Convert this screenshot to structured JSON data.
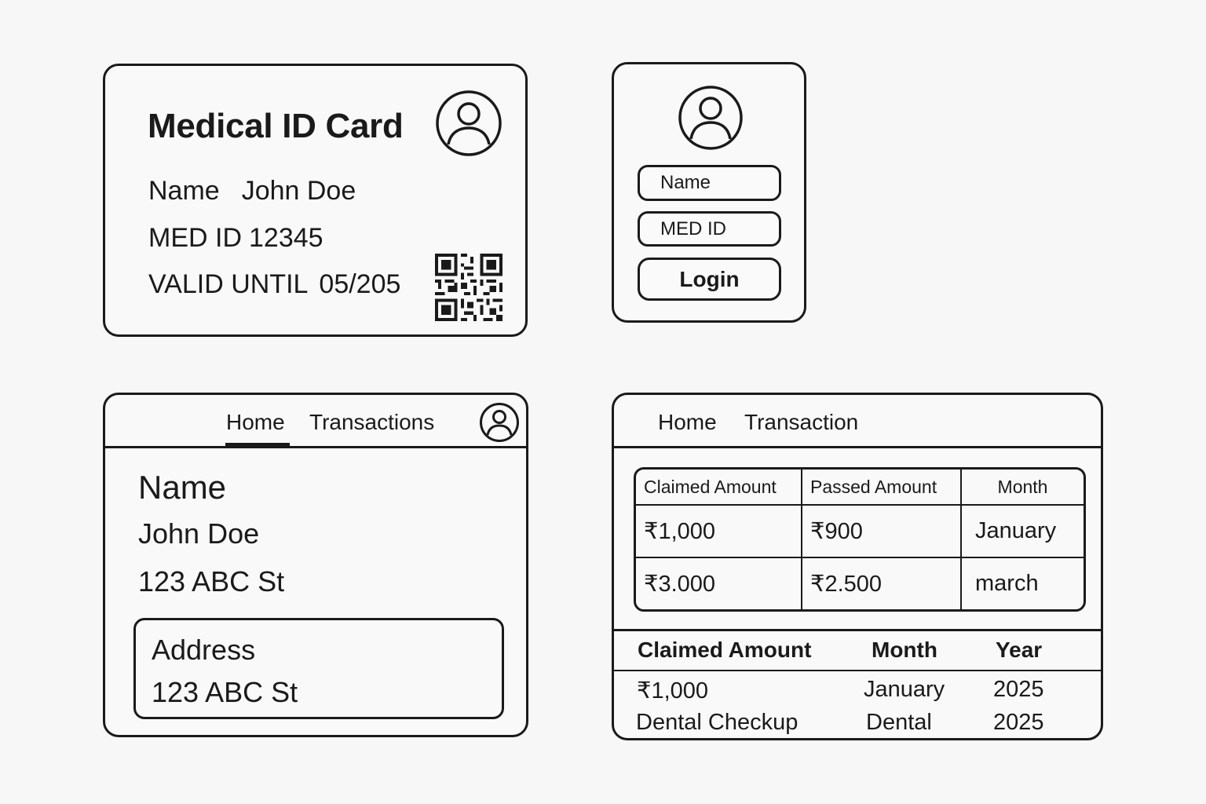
{
  "id_card": {
    "title": "Medical ID Card",
    "name_label": "Name",
    "name_value": "John Doe",
    "med_id_label": "MED ID",
    "med_id_value": "12345",
    "valid_label": "VALID UNTIL",
    "valid_value": "05/205",
    "icons": {
      "avatar": "user-avatar-icon",
      "qr": "qr-code-icon"
    }
  },
  "login": {
    "name_placeholder": "Name",
    "med_id_placeholder": "MED ID",
    "login_label": "Login",
    "icons": {
      "avatar": "user-avatar-icon"
    }
  },
  "profile": {
    "nav": {
      "home": "Home",
      "transactions": "Transactions"
    },
    "name_label": "Name",
    "name_value": "John Doe",
    "address_value": "123 ABC St",
    "address_box": {
      "label": "Address",
      "value": "123 ABC St"
    },
    "icons": {
      "avatar": "user-avatar-icon"
    }
  },
  "transactions": {
    "nav": {
      "home": "Home",
      "transaction": "Transaction"
    },
    "table": {
      "headers": [
        "Claimed Amount",
        "Passed Amount",
        "Month"
      ],
      "rows": [
        [
          "₹1,000",
          "₹900",
          "January"
        ],
        [
          "₹3.000",
          "₹2.500",
          "march"
        ]
      ]
    },
    "summary": {
      "headers": [
        "Claimed Amount",
        "Month",
        "Year"
      ],
      "rows": [
        [
          "₹1,000",
          "January",
          "2025"
        ],
        [
          "Dental Checkup",
          "Dental",
          "2025"
        ]
      ]
    }
  }
}
